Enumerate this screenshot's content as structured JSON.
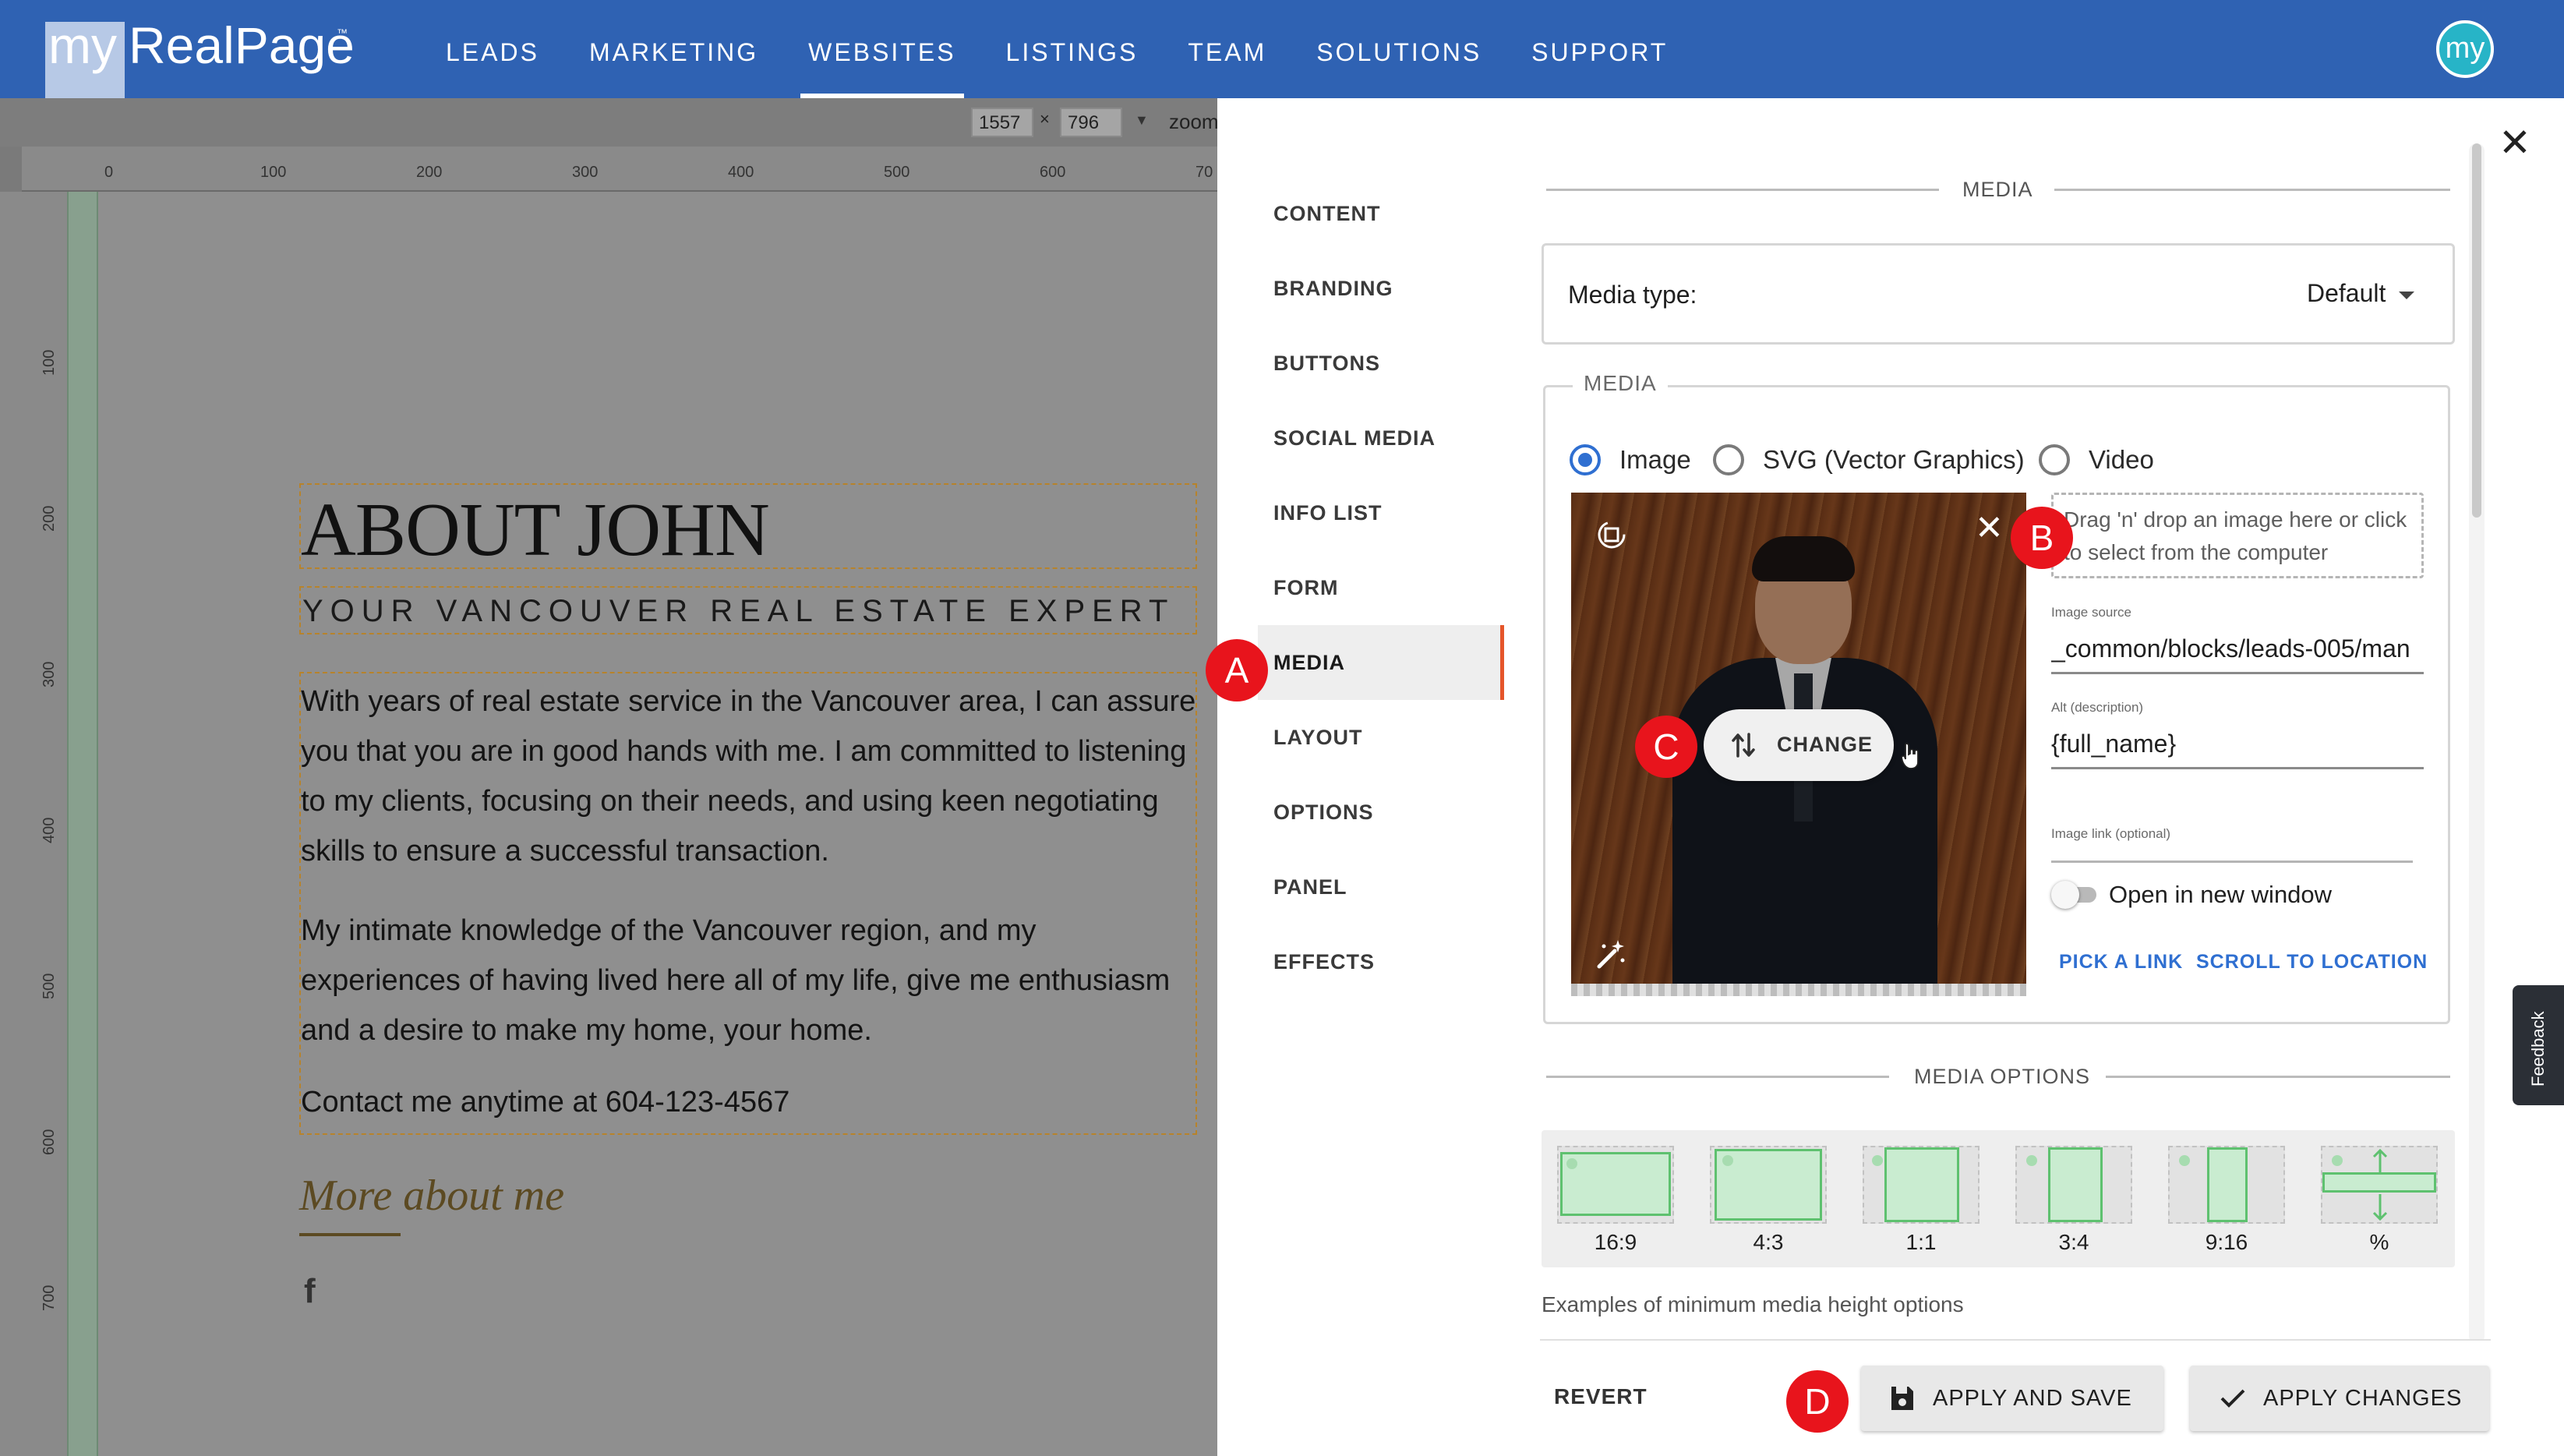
{
  "header": {
    "logo_my": "my",
    "logo_name": "RealPage",
    "logo_tm": "™",
    "nav": [
      "LEADS",
      "MARKETING",
      "WEBSITES",
      "LISTINGS",
      "TEAM",
      "SOLUTIONS",
      "SUPPORT"
    ],
    "active_nav": "WEBSITES",
    "avatar_text": "my"
  },
  "editor_toolbar": {
    "width": "1557",
    "times": "×",
    "height": "796",
    "zoom_label": "zoom"
  },
  "rulers": {
    "top": [
      "0",
      "100",
      "200",
      "300",
      "400",
      "500",
      "600",
      "70"
    ],
    "left": [
      "100",
      "200",
      "300",
      "400",
      "500",
      "600",
      "700"
    ]
  },
  "canvas": {
    "title": "ABOUT JOHN",
    "subtitle": "YOUR VANCOUVER REAL ESTATE EXPERT",
    "paragraphs": [
      "With years of real estate service in the Vancouver area, I can assure you that you are in good hands with me. I am committed to listening to my clients, focusing on their needs, and using keen negotiating skills to ensure a successful transaction.",
      "My intimate knowledge of the Vancouver region, and my experiences of having lived here all of my life, give me enthusiasm and a desire to make my home, your home.",
      "Contact me anytime at 604-123-4567"
    ],
    "more_link": "More about me",
    "social_icon": "f"
  },
  "panel": {
    "menu": [
      "CONTENT",
      "BRANDING",
      "BUTTONS",
      "SOCIAL MEDIA",
      "INFO LIST",
      "FORM",
      "MEDIA",
      "LAYOUT",
      "OPTIONS",
      "PANEL",
      "EFFECTS"
    ],
    "active_menu": "MEDIA",
    "section_media": "MEDIA",
    "media_type_label": "Media type:",
    "media_type_value": "Default",
    "media_legend": "MEDIA",
    "radios": [
      {
        "label": "Image",
        "checked": true
      },
      {
        "label": "SVG (Vector Graphics)",
        "checked": false
      },
      {
        "label": "Video",
        "checked": false
      }
    ],
    "change_button": "CHANGE",
    "drop_zone_text": "Drag 'n' drop an image here or click to select from the computer",
    "image_source_label": "Image source",
    "image_source_value": "_common/blocks/leads-005/man",
    "alt_label": "Alt (description)",
    "alt_value": "{full_name}",
    "link_label": "Image link (optional)",
    "open_new_window": "Open in new window",
    "open_new_window_on": false,
    "pick_link": "PICK A LINK",
    "scroll_to_location": "SCROLL TO LOCATION",
    "section_media_options": "MEDIA OPTIONS",
    "ratio_options": [
      "16:9",
      "4:3",
      "1:1",
      "3:4",
      "9:16",
      "%"
    ],
    "examples_text": "Examples of minimum media height options",
    "revert": "REVERT",
    "apply_save": "APPLY AND SAVE",
    "apply_changes": "APPLY CHANGES",
    "feedback": "Feedback"
  },
  "markers": [
    "A",
    "B",
    "C",
    "D"
  ],
  "colors": {
    "topbar": "#2f62b3",
    "accent_blue": "#2f6fd1",
    "active_menu_border": "#e5552a",
    "marker_red": "#e8141c",
    "ratio_green": "#5ec16f"
  }
}
